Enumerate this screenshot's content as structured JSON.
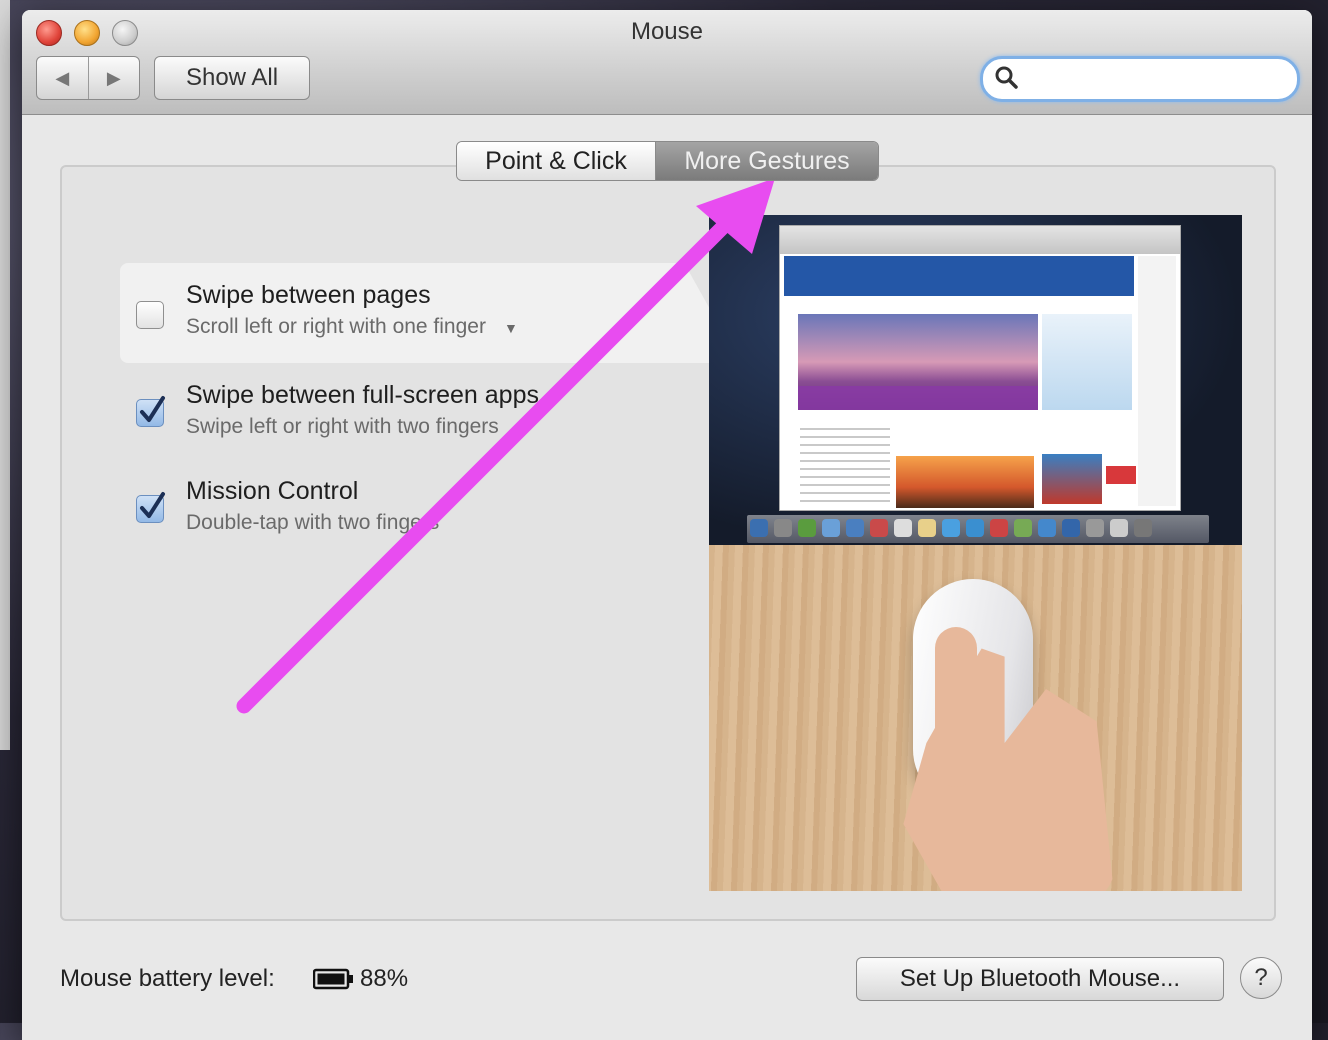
{
  "window": {
    "title": "Mouse"
  },
  "toolbar": {
    "back_label": "◀",
    "forward_label": "▶",
    "show_all_label": "Show All",
    "search_placeholder": ""
  },
  "tabs": [
    {
      "label": "Point & Click",
      "selected": false
    },
    {
      "label": "More Gestures",
      "selected": true
    }
  ],
  "gestures": [
    {
      "title": "Swipe between pages",
      "description": "Scroll left or right with one finger",
      "checked": false,
      "has_dropdown": true
    },
    {
      "title": "Swipe between full-screen apps",
      "description": "Swipe left or right with two fingers",
      "checked": true
    },
    {
      "title": "Mission Control",
      "description": "Double-tap with two fingers",
      "checked": true
    }
  ],
  "footer": {
    "battery_label": "Mouse battery level:",
    "battery_value": "88%",
    "bluetooth_button": "Set Up Bluetooth Mouse...",
    "help_button": "?"
  },
  "colors": {
    "annotation_arrow": "#e84cf0",
    "selected_tab": "#8e8e8e",
    "checkbox_checked": "#93b9e6"
  }
}
